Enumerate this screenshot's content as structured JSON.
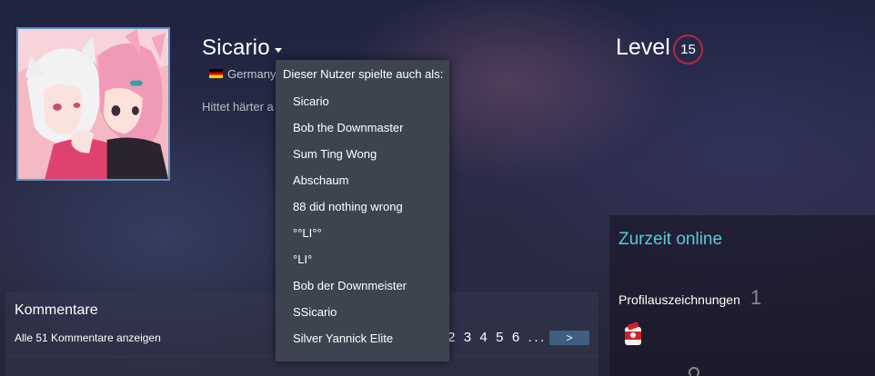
{
  "profile": {
    "persona_name": "Sicario",
    "country": "Germany",
    "summary": "Hittet härter a",
    "avatar_icon": "anime-avatar-image"
  },
  "alias_dropdown": {
    "header": "Dieser Nutzer spielte auch als:",
    "items": [
      "Sicario",
      "Bob the Downmaster",
      "Sum Ting Wong",
      "Abschaum",
      "88 did nothing wrong",
      "°°LI°°",
      "°LI°",
      "Bob der Downmeister",
      "SSicario",
      "Silver Yannick Elite"
    ]
  },
  "level": {
    "label": "Level",
    "value": "15",
    "badge_color": "#c0243d"
  },
  "status": {
    "online_text": "Zurzeit online",
    "online_color": "#57cbde"
  },
  "badges": {
    "label": "Profilauszeichnungen",
    "count": "1",
    "icon": "badge-icon"
  },
  "comments": {
    "title": "Kommentare",
    "view_all": "Alle 51 Kommentare anzeigen",
    "pagination": "2 3 4 5 6 ... 9",
    "next_label": ">"
  }
}
